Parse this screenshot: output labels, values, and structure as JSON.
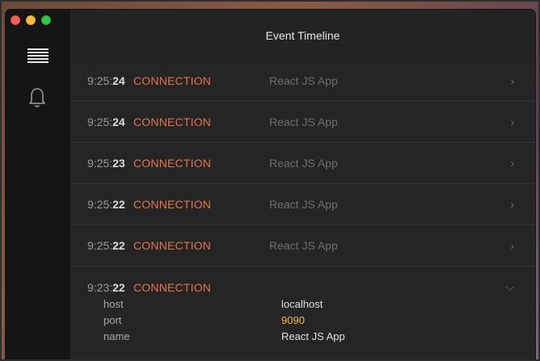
{
  "window": {
    "title": "Event Timeline"
  },
  "sidebar": {
    "icons": [
      "menu-icon",
      "bell-icon"
    ]
  },
  "events": [
    {
      "time_hm": "9:25:",
      "time_s": "24",
      "type": "CONNECTION",
      "message": "React JS App",
      "expanded": false
    },
    {
      "time_hm": "9:25:",
      "time_s": "24",
      "type": "CONNECTION",
      "message": "React JS App",
      "expanded": false
    },
    {
      "time_hm": "9:25:",
      "time_s": "23",
      "type": "CONNECTION",
      "message": "React JS App",
      "expanded": false
    },
    {
      "time_hm": "9:25:",
      "time_s": "22",
      "type": "CONNECTION",
      "message": "React JS App",
      "expanded": false
    },
    {
      "time_hm": "9:25:",
      "time_s": "22",
      "type": "CONNECTION",
      "message": "React JS App",
      "expanded": false
    },
    {
      "time_hm": "9:23:",
      "time_s": "22",
      "type": "CONNECTION",
      "message": "",
      "expanded": true
    }
  ],
  "details": [
    {
      "key": "host",
      "value": "localhost"
    },
    {
      "key": "port",
      "value": "9090"
    },
    {
      "key": "name",
      "value": "React JS App"
    }
  ],
  "colors": {
    "accent": "#e4734a",
    "number": "#f3b84a"
  }
}
